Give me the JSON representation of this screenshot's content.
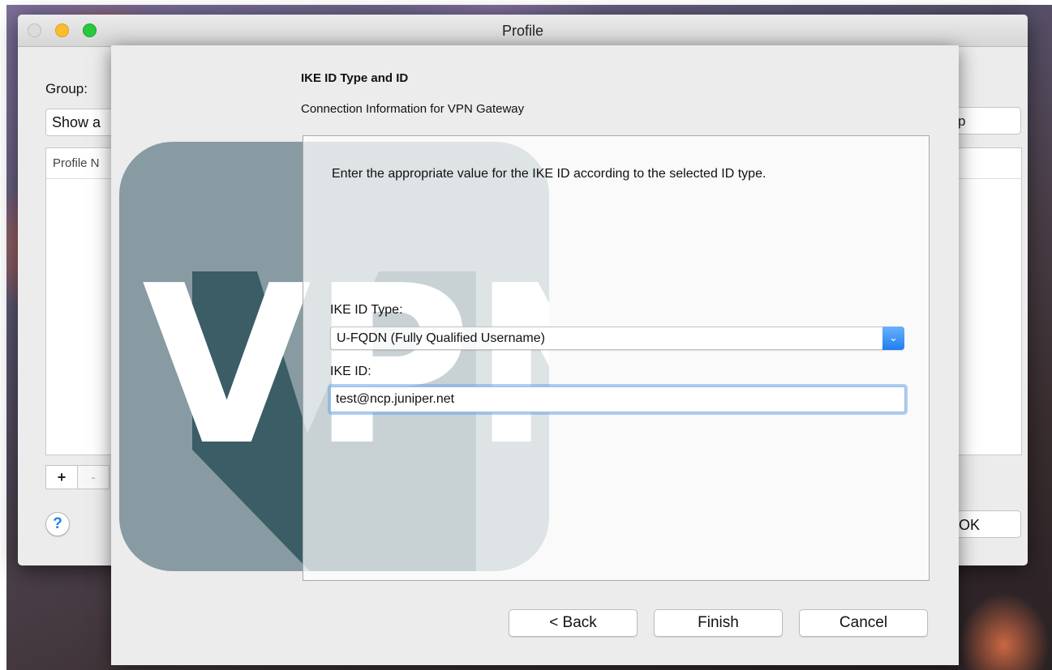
{
  "window": {
    "title": "Profile",
    "group_label": "Group:",
    "group_value": "Show a",
    "right_top_button_partial": "p",
    "list_header": "Profile N",
    "add_label": "+",
    "remove_label": "-",
    "help_label": "?",
    "ok_label": "OK"
  },
  "sheet": {
    "title": "IKE ID Type and ID",
    "subtitle": "Connection Information for VPN Gateway",
    "instruction": "Enter the appropriate value for the IKE ID according to the selected ID type.",
    "ike_id_type_label": "IKE ID Type:",
    "ike_id_type_value": "U-FQDN (Fully Qualified Username)",
    "ike_id_label": "IKE ID:",
    "ike_id_value": "test@ncp.juniper.net",
    "back_label": "< Back",
    "finish_label": "Finish",
    "cancel_label": "Cancel"
  },
  "logo": {
    "text": "VPN",
    "colors": {
      "tile": "#889aa2",
      "shadow": "#3a5d66",
      "letters": "#ffffff"
    }
  },
  "colors": {
    "accent": "#1f7ef0",
    "window_bg": "#ececec"
  }
}
